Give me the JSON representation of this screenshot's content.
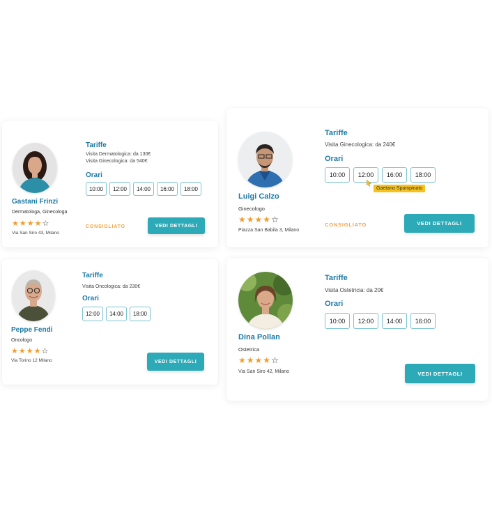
{
  "cards": [
    {
      "name": "Gastani Frinzi",
      "specialty": "Dermatologa, Ginecologa",
      "rating": 4,
      "address": "Via San Siro 43, Milano",
      "tariffe_title": "Tariffe",
      "tariffs": [
        "Visita Dermatologica: da 130€",
        "Visita Ginecologica: da 540€"
      ],
      "orari_title": "Orari",
      "slots": [
        "10:00",
        "12:00",
        "14:00",
        "16:00",
        "18:00"
      ],
      "recommended": "CONSIGLIATO",
      "button": "VEDI DETTAGLI"
    },
    {
      "name": "Luigi Calzo",
      "specialty": "Ginecologo",
      "rating": 4,
      "address": "Piazza San Babila 3, Milano",
      "tariffe_title": "Tariffe",
      "tariffs": [
        "Visita Ginecologica: da 240€"
      ],
      "orari_title": "Orari",
      "slots": [
        "10:00",
        "12:00",
        "16:00",
        "18:00"
      ],
      "recommended": "CONSIGLIATO",
      "button": "VEDI DETTAGLI",
      "tooltip": "Gaetano Spampinato"
    },
    {
      "name": "Peppe Fendi",
      "specialty": "Oncologo",
      "rating": 4,
      "address": "Via Torino 12 Milano",
      "tariffe_title": "Tariffe",
      "tariffs": [
        "Visita Oncologica: da 230€"
      ],
      "orari_title": "Orari",
      "slots": [
        "12:00",
        "14:00",
        "18:00"
      ],
      "button": "VEDI DETTAGLI"
    },
    {
      "name": "Dina Pollan",
      "specialty": "Ostetrica",
      "rating": 4,
      "address": "Via San Siro 42, Milano",
      "tariffe_title": "Tariffe",
      "tariffs": [
        "Visita Ostetricia: da 20€"
      ],
      "orari_title": "Orari",
      "slots": [
        "10:00",
        "12:00",
        "14:00",
        "16:00"
      ],
      "button": "VEDI DETTAGLI"
    }
  ],
  "colors": {
    "accent_blue": "#1b7aa5",
    "button_teal": "#2daab7",
    "slot_border": "#7cc4d1",
    "star_orange": "#f39c2b",
    "recommended_orange": "#f0a64a",
    "tooltip_yellow": "#f6c21b"
  }
}
